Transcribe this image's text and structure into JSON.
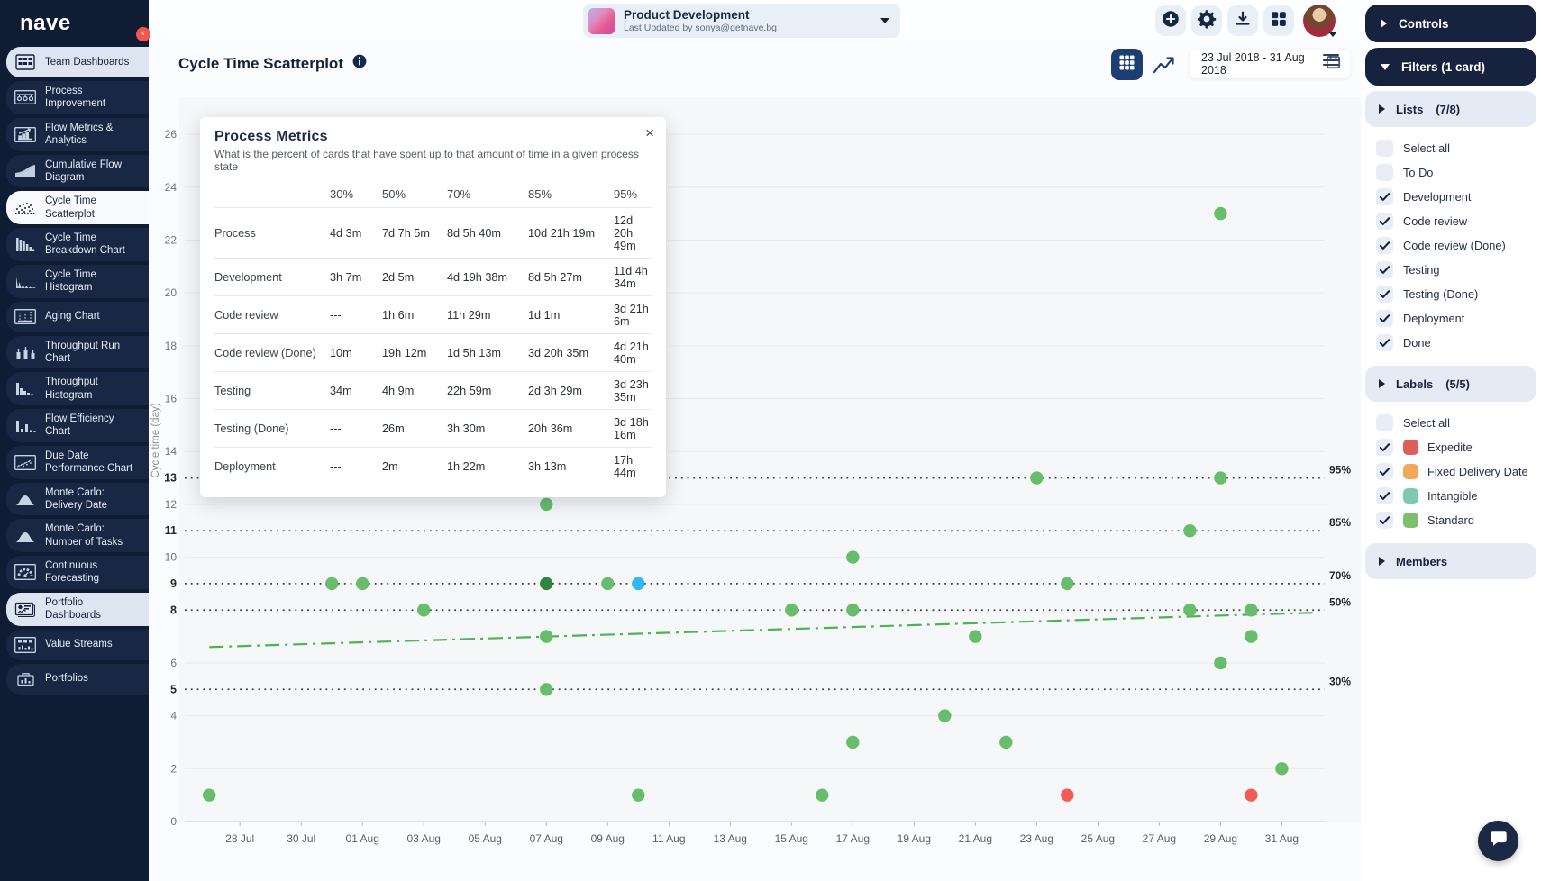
{
  "app": {
    "logo_text": "nave"
  },
  "sidebar": {
    "items": [
      {
        "label": "Team Dashboards",
        "icon": "team-dashboards",
        "style": "group"
      },
      {
        "label": "Process Improvement",
        "icon": "process-improvement",
        "style": "dark"
      },
      {
        "label": "Flow Metrics & Analytics",
        "icon": "flow-metrics",
        "style": "dark"
      },
      {
        "label": "Cumulative Flow Diagram",
        "icon": "cumulative-flow",
        "style": "dark"
      },
      {
        "label": "Cycle Time Scatterplot",
        "icon": "cycle-time-scatterplot",
        "style": "active"
      },
      {
        "label": "Cycle Time Breakdown Chart",
        "icon": "cycle-time-breakdown",
        "style": "dark"
      },
      {
        "label": "Cycle Time Histogram",
        "icon": "cycle-time-histogram",
        "style": "dark"
      },
      {
        "label": "Aging Chart",
        "icon": "aging-chart",
        "style": "dark"
      },
      {
        "label": "Throughput Run Chart",
        "icon": "throughput-run",
        "style": "dark"
      },
      {
        "label": "Throughput Histogram",
        "icon": "throughput-histogram",
        "style": "dark"
      },
      {
        "label": "Flow Efficiency Chart",
        "icon": "flow-efficiency",
        "style": "dark"
      },
      {
        "label": "Due Date Performance Chart",
        "icon": "due-date-performance",
        "style": "dark"
      },
      {
        "label": "Monte Carlo: Delivery Date",
        "icon": "monte-carlo-delivery",
        "style": "dark"
      },
      {
        "label": "Monte Carlo: Number of Tasks",
        "icon": "monte-carlo-tasks",
        "style": "dark"
      },
      {
        "label": "Continuous Forecasting",
        "icon": "continuous-forecasting",
        "style": "dark"
      },
      {
        "label": "Portfolio Dashboards",
        "icon": "portfolio-dashboards",
        "style": "group"
      },
      {
        "label": "Value Streams",
        "icon": "value-streams",
        "style": "dark"
      },
      {
        "label": "Portfolios",
        "icon": "portfolios",
        "style": "dark"
      }
    ]
  },
  "topbar": {
    "board": {
      "title": "Product Development",
      "subtitle": "Last Updated by sonya@getnave.bg"
    },
    "icons": [
      "add-icon",
      "settings-icon",
      "download-icon",
      "apps-icon",
      "avatar"
    ]
  },
  "chart_header": {
    "title": "Cycle Time Scatterplot",
    "date_range": "23 Jul 2018 - 31 Aug 2018"
  },
  "popup": {
    "title": "Process Metrics",
    "subtitle": "What is the percent of cards that have spent up to that amount of time in a given process state",
    "close_label": "×",
    "table": {
      "columns": [
        "30%",
        "50%",
        "70%",
        "85%",
        "95%"
      ],
      "rows": [
        {
          "label": "Process",
          "values": [
            "4d 3m",
            "7d 7h 5m",
            "8d 5h 40m",
            "10d 21h 19m",
            "12d 20h 49m"
          ]
        },
        {
          "label": "Development",
          "values": [
            "3h 7m",
            "2d 5m",
            "4d 19h 38m",
            "8d 5h 27m",
            "11d 4h 34m"
          ]
        },
        {
          "label": "Code review",
          "values": [
            "---",
            "1h 6m",
            "11h 29m",
            "1d 1m",
            "3d 21h 6m"
          ]
        },
        {
          "label": "Code review (Done)",
          "values": [
            "10m",
            "19h 12m",
            "1d 5h 13m",
            "3d 20h 35m",
            "4d 21h 40m"
          ]
        },
        {
          "label": "Testing",
          "values": [
            "34m",
            "4h 9m",
            "22h 59m",
            "2d 3h 29m",
            "3d 23h 35m"
          ]
        },
        {
          "label": "Testing (Done)",
          "values": [
            "---",
            "26m",
            "3h 30m",
            "20h 36m",
            "3d 18h 16m"
          ]
        },
        {
          "label": "Deployment",
          "values": [
            "---",
            "2m",
            "1h 22m",
            "3h 13m",
            "17h 44m"
          ]
        }
      ]
    }
  },
  "chart_data": {
    "type": "scatter",
    "title": "Cycle Time Scatterplot",
    "ylabel": "Cycle time (day)",
    "ylim": [
      0,
      27
    ],
    "grid": true,
    "x_ticks": [
      "28 Jul",
      "30 Jul",
      "01 Aug",
      "03 Aug",
      "05 Aug",
      "07 Aug",
      "09 Aug",
      "11 Aug",
      "13 Aug",
      "15 Aug",
      "17 Aug",
      "19 Aug",
      "21 Aug",
      "23 Aug",
      "25 Aug",
      "27 Aug",
      "29 Aug",
      "31 Aug"
    ],
    "y_ticks_even": [
      0,
      2,
      4,
      6,
      8,
      10,
      12,
      14,
      16,
      18,
      20,
      22,
      24,
      26
    ],
    "y_ticks_percentile": [
      5,
      8,
      9,
      11,
      13
    ],
    "percentile_lines": [
      {
        "label": "30%",
        "value": 5
      },
      {
        "label": "50%",
        "value": 8
      },
      {
        "label": "70%",
        "value": 9
      },
      {
        "label": "85%",
        "value": 11
      },
      {
        "label": "95%",
        "value": 13
      }
    ],
    "trend_line": {
      "start_date": "27 Jul",
      "end_date": "01 Sep",
      "start_value": 6.6,
      "end_value": 7.9
    },
    "points": [
      {
        "date": "27 Jul",
        "days": 1,
        "color": "green"
      },
      {
        "date": "31 Jul",
        "days": 9,
        "color": "green"
      },
      {
        "date": "01 Aug",
        "days": 9,
        "color": "green"
      },
      {
        "date": "03 Aug",
        "days": 8,
        "color": "green"
      },
      {
        "date": "07 Aug",
        "days": 12,
        "color": "green"
      },
      {
        "date": "07 Aug",
        "days": 9,
        "color": "dark_green"
      },
      {
        "date": "07 Aug",
        "days": 7,
        "color": "green"
      },
      {
        "date": "07 Aug",
        "days": 5,
        "color": "green"
      },
      {
        "date": "09 Aug",
        "days": 9,
        "color": "green"
      },
      {
        "date": "10 Aug",
        "days": 9,
        "color": "blue"
      },
      {
        "date": "10 Aug",
        "days": 1,
        "color": "green"
      },
      {
        "date": "15 Aug",
        "days": 8,
        "color": "green"
      },
      {
        "date": "16 Aug",
        "days": 1,
        "color": "green"
      },
      {
        "date": "17 Aug",
        "days": 10,
        "color": "green"
      },
      {
        "date": "17 Aug",
        "days": 8,
        "color": "green"
      },
      {
        "date": "17 Aug",
        "days": 3,
        "color": "green"
      },
      {
        "date": "20 Aug",
        "days": 4,
        "color": "green"
      },
      {
        "date": "21 Aug",
        "days": 7,
        "color": "green"
      },
      {
        "date": "22 Aug",
        "days": 3,
        "color": "green"
      },
      {
        "date": "23 Aug",
        "days": 13,
        "color": "green"
      },
      {
        "date": "24 Aug",
        "days": 9,
        "color": "green"
      },
      {
        "date": "24 Aug",
        "days": 1,
        "color": "red"
      },
      {
        "date": "28 Aug",
        "days": 11,
        "color": "green"
      },
      {
        "date": "28 Aug",
        "days": 8,
        "color": "green"
      },
      {
        "date": "29 Aug",
        "days": 23,
        "color": "green"
      },
      {
        "date": "29 Aug",
        "days": 13,
        "color": "green"
      },
      {
        "date": "29 Aug",
        "days": 6,
        "color": "green"
      },
      {
        "date": "30 Aug",
        "days": 8,
        "color": "green"
      },
      {
        "date": "30 Aug",
        "days": 7,
        "color": "green"
      },
      {
        "date": "30 Aug",
        "days": 1,
        "color": "red"
      },
      {
        "date": "31 Aug",
        "days": 2,
        "color": "green"
      }
    ],
    "colors": {
      "green": "#68bd6c",
      "dark_green": "#2c8540",
      "red": "#f45b55",
      "blue": "#2fb9f2",
      "trend": "#4db356",
      "grid": "#e9eaec",
      "plot_bg": "#f6f7f8"
    },
    "legend_position": "none"
  },
  "right_panel": {
    "controls_label": "Controls",
    "filters_label": "Filters (1 card)",
    "lists": {
      "name": "Lists",
      "count": "(7/8)",
      "items": [
        {
          "label": "Select all",
          "checked": false
        },
        {
          "label": "To Do",
          "checked": false
        },
        {
          "label": "Development",
          "checked": true
        },
        {
          "label": "Code review",
          "checked": true
        },
        {
          "label": "Code review (Done)",
          "checked": true
        },
        {
          "label": "Testing",
          "checked": true
        },
        {
          "label": "Testing (Done)",
          "checked": true
        },
        {
          "label": "Deployment",
          "checked": true
        },
        {
          "label": "Done",
          "checked": true
        }
      ]
    },
    "labels": {
      "name": "Labels",
      "count": "(5/5)",
      "items": [
        {
          "label": "Select all",
          "checked": false
        },
        {
          "label": "Expedite",
          "checked": true,
          "swatch": "#dd5f59"
        },
        {
          "label": "Fixed Delivery Date",
          "checked": true,
          "swatch": "#f0a85c"
        },
        {
          "label": "Intangible",
          "checked": true,
          "swatch": "#7fcaae"
        },
        {
          "label": "Standard",
          "checked": true,
          "swatch": "#7dbf6d"
        }
      ]
    },
    "members": {
      "name": "Members"
    }
  }
}
